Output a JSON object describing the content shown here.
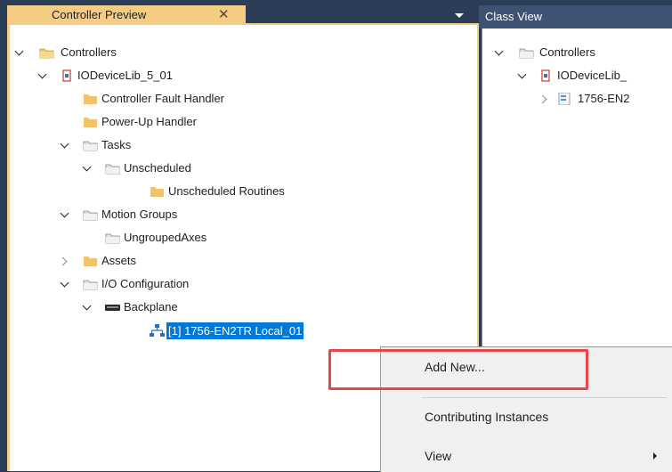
{
  "left_panel": {
    "tab_title": "Controller Preview",
    "close_glyph": "✕",
    "tree": [
      {
        "label": "Controllers",
        "icon": "folder-open-icon",
        "chevron": "down"
      },
      {
        "label": "IODeviceLib_5_01",
        "icon": "controller-icon",
        "chevron": "down"
      },
      {
        "label": "Controller Fault Handler",
        "icon": "folder-icon",
        "chevron": "none"
      },
      {
        "label": "Power-Up Handler",
        "icon": "folder-icon",
        "chevron": "none"
      },
      {
        "label": "Tasks",
        "icon": "folder-open-icon",
        "chevron": "down"
      },
      {
        "label": "Unscheduled",
        "icon": "folder-open-icon",
        "chevron": "down"
      },
      {
        "label": "Unscheduled Routines",
        "icon": "folder-icon",
        "chevron": "none"
      },
      {
        "label": "Motion Groups",
        "icon": "folder-open-icon",
        "chevron": "down"
      },
      {
        "label": "UngroupedAxes",
        "icon": "folder-open-icon",
        "chevron": "none"
      },
      {
        "label": "Assets",
        "icon": "folder-icon",
        "chevron": "right"
      },
      {
        "label": "I/O Configuration",
        "icon": "folder-open-icon",
        "chevron": "down"
      },
      {
        "label": "Backplane",
        "icon": "backplane-icon",
        "chevron": "down"
      },
      {
        "label": "[1] 1756-EN2TR Local_01",
        "icon": "network-module-icon",
        "chevron": "none",
        "selected": true
      }
    ]
  },
  "right_panel": {
    "tab_title": "Class View",
    "tree": [
      {
        "label": "Controllers",
        "icon": "folder-open-icon",
        "chevron": "down"
      },
      {
        "label": "IODeviceLib_",
        "icon": "controller-icon",
        "chevron": "down"
      },
      {
        "label": "1756-EN2",
        "icon": "module-icon",
        "chevron": "right"
      }
    ]
  },
  "context_menu": {
    "items": [
      {
        "label": "Add New...",
        "highlighted": true
      },
      {
        "label": "Contributing Instances"
      },
      {
        "label": "View",
        "has_submenu": true
      }
    ]
  },
  "colors": {
    "chrome": "#2b3d57",
    "tab_active": "#f5cc84",
    "selection": "#0078d7",
    "highlight_box": "#e8474a",
    "folder": "#f2c46a"
  }
}
